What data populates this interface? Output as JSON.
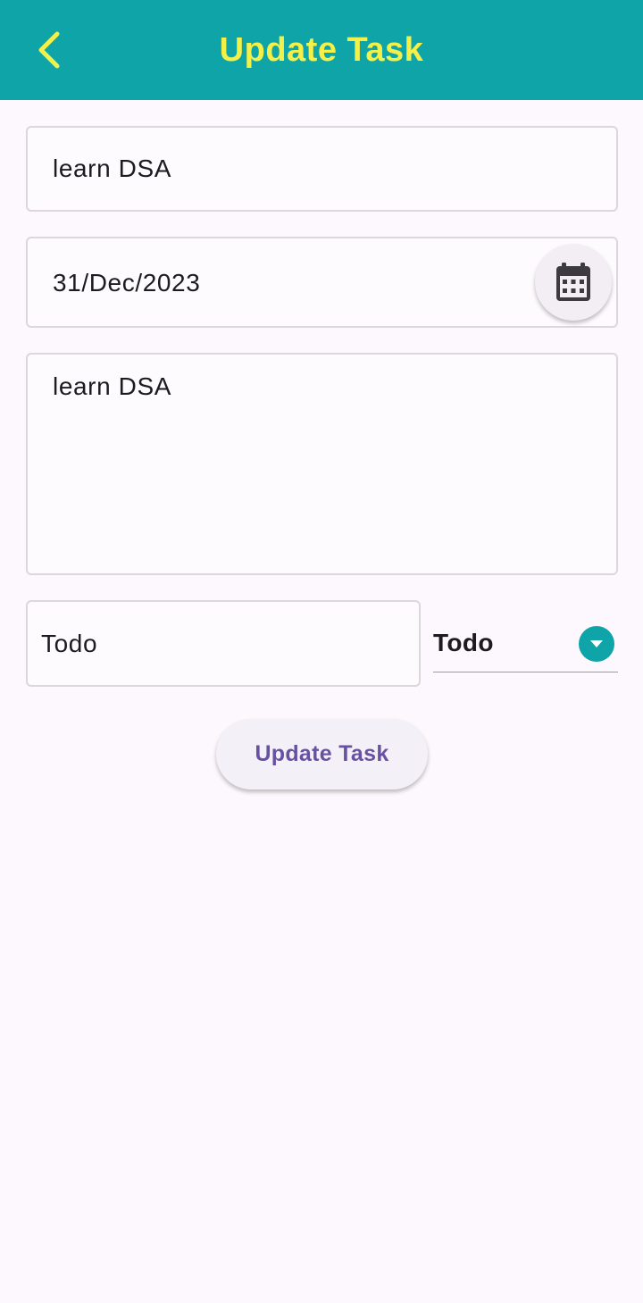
{
  "appbar": {
    "title": "Update Task",
    "back_icon": "chevron-left-icon",
    "bg_color": "#0fa5a8",
    "title_color": "#f4f04a"
  },
  "form": {
    "title_value": "learn DSA",
    "date_value": "31/Dec/2023",
    "calendar_icon": "calendar-icon",
    "description_value": "learn DSA",
    "status_value": "Todo",
    "dropdown_selected": "Todo",
    "dropdown_icon": "dropdown-arrow-icon"
  },
  "actions": {
    "update_label": "Update Task",
    "update_color": "#6850a2"
  }
}
